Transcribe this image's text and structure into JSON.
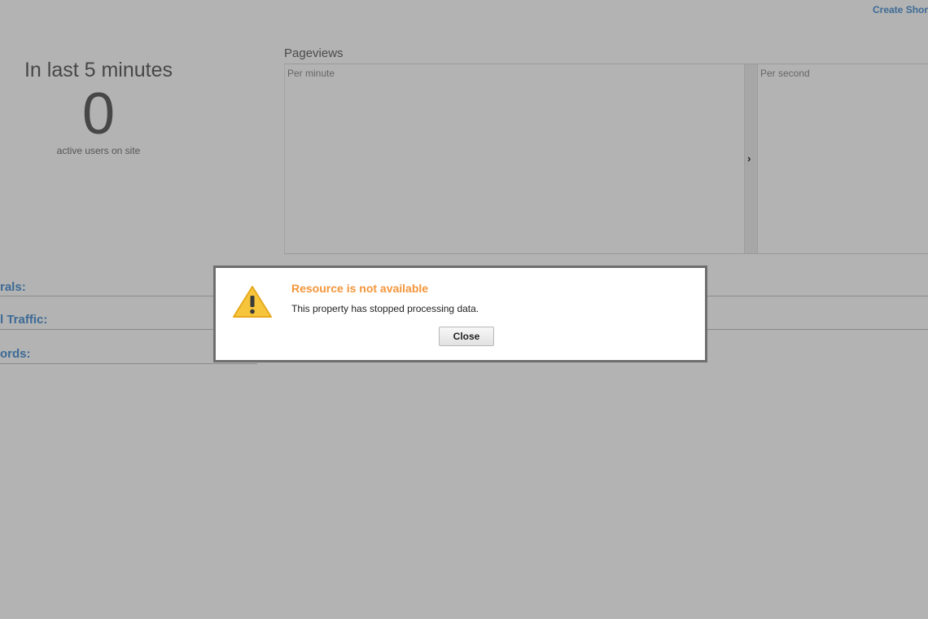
{
  "header": {
    "create_shortcut_label": "Create Shor"
  },
  "active_users": {
    "headline": "In last 5 minutes",
    "count": "0",
    "caption": "active users on site"
  },
  "pageviews": {
    "title": "Pageviews",
    "per_minute_label": "Per minute",
    "per_second_label": "Per second",
    "toggle_icon": "chevron-right-icon"
  },
  "side_links": [
    {
      "label": "rals:"
    },
    {
      "label": "l Traffic:"
    },
    {
      "label": "ords:"
    }
  ],
  "dialog": {
    "icon": "warning-icon",
    "title": "Resource is not available",
    "message": "This property has stopped processing data.",
    "close_label": "Close",
    "title_color": "#f4953a"
  },
  "colors": {
    "link": "#3d6a96",
    "overlay_background": "#b2b3b2"
  }
}
